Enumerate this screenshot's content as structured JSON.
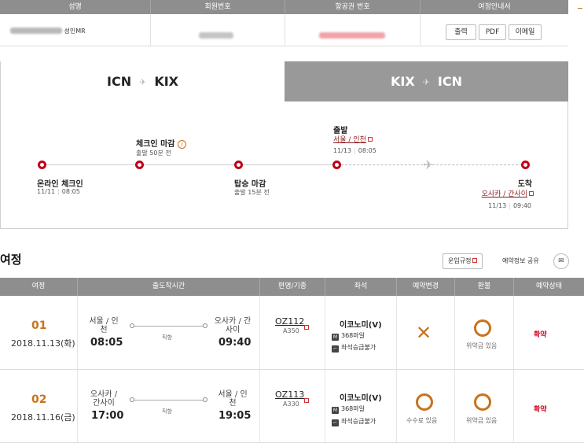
{
  "passenger": {
    "headers": [
      "성명",
      "회원번호",
      "항공권 번호",
      "여정안내서"
    ],
    "name_suffix": "성인MR",
    "buttons": {
      "print": "출력",
      "pdf": "PDF",
      "email": "이메일"
    }
  },
  "route_tabs": [
    {
      "from": "ICN",
      "to": "KIX",
      "active": true
    },
    {
      "from": "KIX",
      "to": "ICN",
      "active": false
    }
  ],
  "timeline": {
    "online_checkin": {
      "title": "온라인 체크인",
      "date": "11/11",
      "time": "08:05"
    },
    "checkin_close": {
      "title": "체크인 마감",
      "note": "출발 50분 전"
    },
    "boarding_close": {
      "title": "탑승 마감",
      "note": "출발 15분 전"
    },
    "departure": {
      "title": "출발",
      "place": "서울 / 인천",
      "date": "11/13",
      "time": "08:05"
    },
    "arrival": {
      "title": "도착",
      "place": "오사카 / 간사이",
      "date": "11/13",
      "time": "09:40"
    }
  },
  "itinerary": {
    "title": "여정",
    "rules_button": "운임규정",
    "share_label": "예약정보 공유",
    "headers": [
      "여정",
      "출도착시간",
      "편명/기종",
      "좌석",
      "예약변경",
      "환불",
      "예약상태"
    ],
    "rows": [
      {
        "num": "01",
        "date": "2018.11.13(화)",
        "from_city": "서울 / 인천",
        "from_time": "08:05",
        "direct": "직항",
        "to_city": "오사카 / 간사이",
        "to_time": "09:40",
        "flight": "OZ112",
        "aircraft": "A350",
        "seat_class": "이코노미(V)",
        "miles": "368마일",
        "seat_note": "좌석승급불가",
        "change_mark": "✕",
        "change_note": "",
        "refund_note": "위약금 있음",
        "status": "확약"
      },
      {
        "num": "02",
        "date": "2018.11.16(금)",
        "from_city": "오사카 / 간사이",
        "from_time": "17:00",
        "direct": "직항",
        "to_city": "서울 / 인천",
        "to_time": "19:05",
        "flight": "OZ113",
        "aircraft": "A330",
        "seat_class": "이코노미(V)",
        "miles": "368마일",
        "seat_note": "좌석승급불가",
        "change_mark": "",
        "change_note": "수수료 있음",
        "refund_note": "위약금 있음",
        "status": "확약"
      }
    ]
  },
  "colors": {
    "accent": "#c8731c",
    "red": "#c00018",
    "header": "#8e8e8e",
    "status": "#d0021b"
  }
}
